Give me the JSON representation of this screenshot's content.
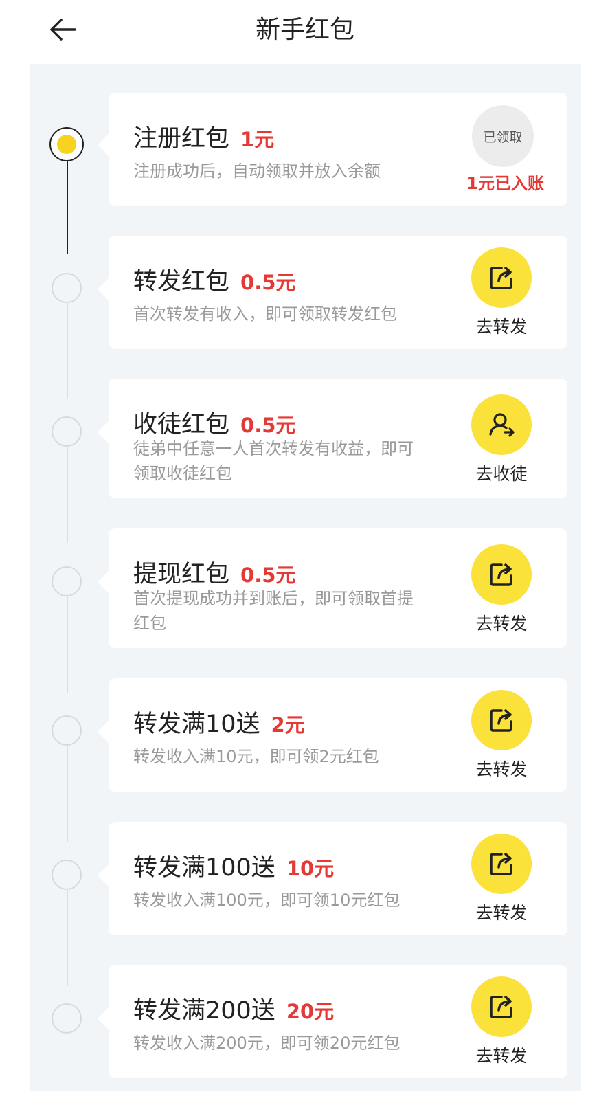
{
  "header": {
    "title": "新手红包",
    "back_icon": "arrow-left-icon"
  },
  "colors": {
    "accent_yellow": "#fbe23b",
    "amount_red": "#e53935",
    "panel_bg": "#f2f5f8"
  },
  "items": [
    {
      "name": "注册红包",
      "amount": "1元",
      "desc": "注册成功后，自动领取并放入余额",
      "state": "claimed",
      "badge": "已领取",
      "note": "1元已入账"
    },
    {
      "name": "转发红包",
      "amount": "0.5元",
      "desc": "首次转发有收入，即可领取转发红包",
      "icon": "share-icon",
      "action": "去转发"
    },
    {
      "name": "收徒红包",
      "amount": "0.5元",
      "desc": "徒弟中任意一人首次转发有收益，即可领取收徒红包",
      "icon": "user-add-icon",
      "action": "去收徒"
    },
    {
      "name": "提现红包",
      "amount": "0.5元",
      "desc": "首次提现成功并到账后，即可领取首提红包",
      "icon": "share-icon",
      "action": "去转发"
    },
    {
      "name": "转发满10送",
      "amount": "2元",
      "desc": "转发收入满10元，即可领2元红包",
      "icon": "share-icon",
      "action": "去转发"
    },
    {
      "name": "转发满100送",
      "amount": "10元",
      "desc": "转发收入满100元，即可领10元红包",
      "icon": "share-icon",
      "action": "去转发"
    },
    {
      "name": "转发满200送",
      "amount": "20元",
      "desc": "转发收入满200元，即可领20元红包",
      "icon": "share-icon",
      "action": "去转发"
    }
  ]
}
